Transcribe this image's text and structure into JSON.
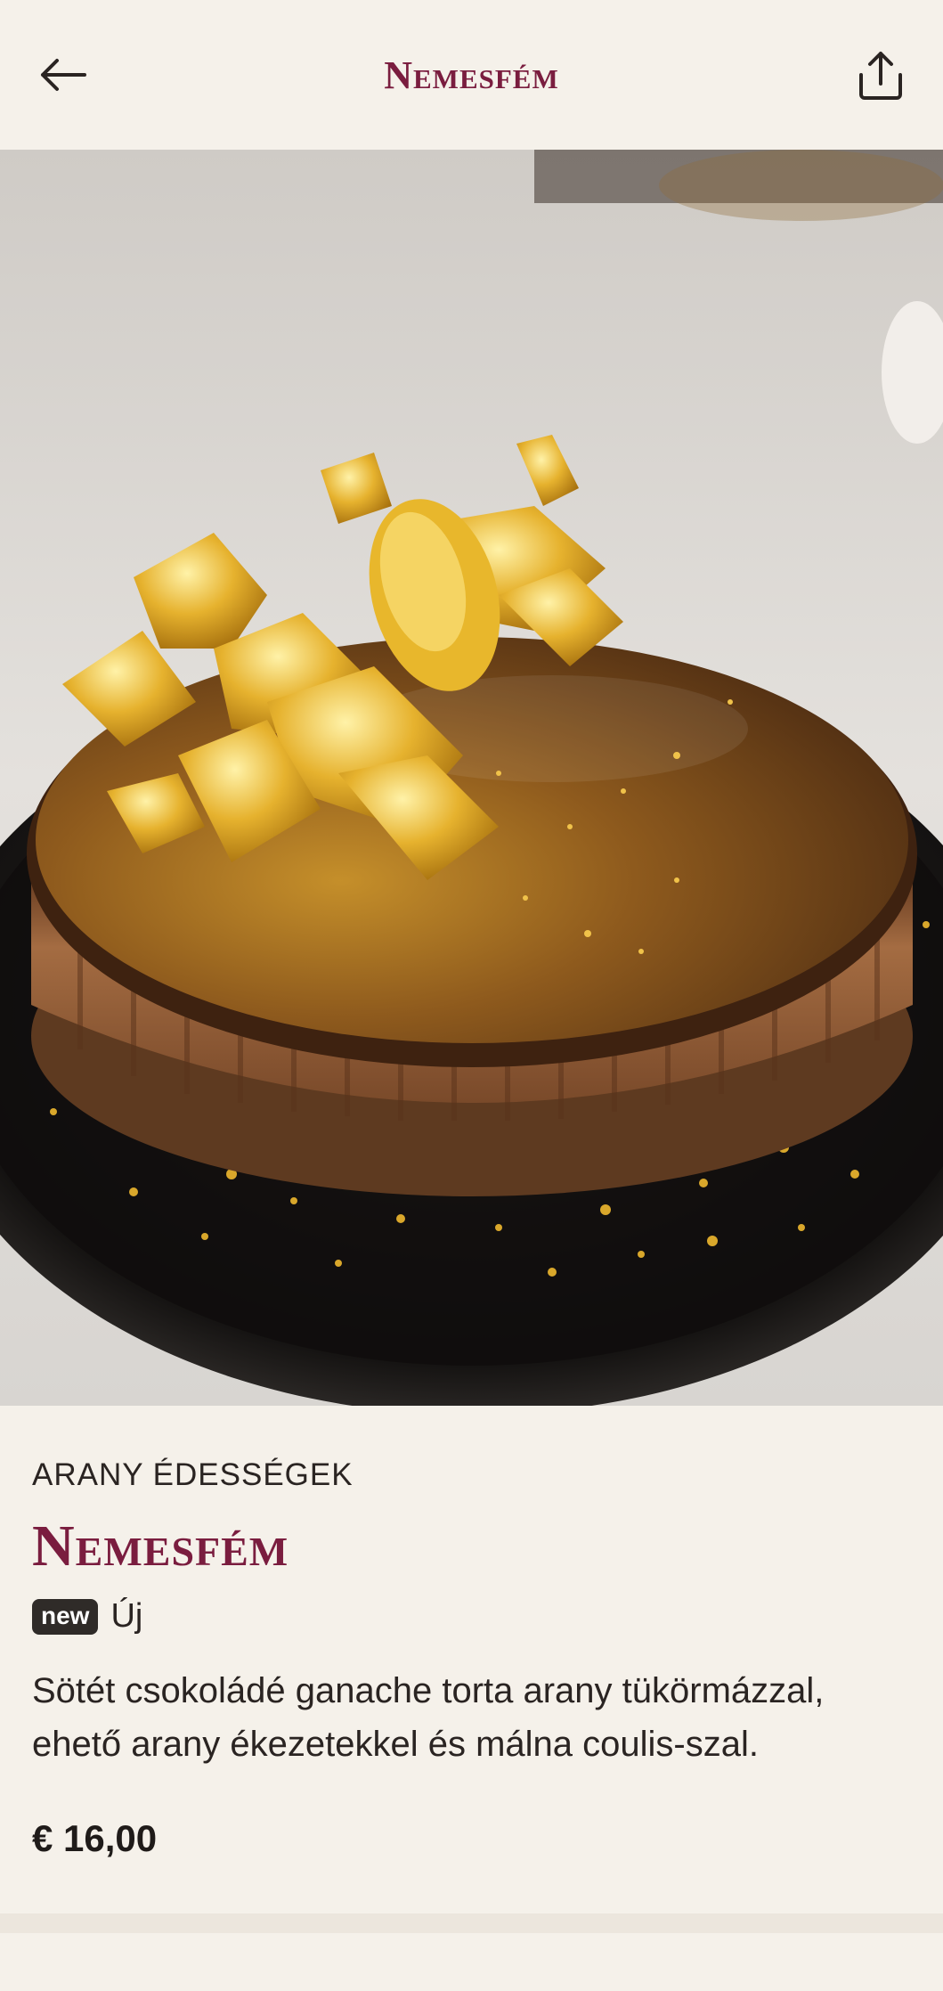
{
  "header": {
    "title": "Nemesfém",
    "back_icon": "arrow-left-icon",
    "share_icon": "share-upload-icon"
  },
  "hero": {
    "image": "chocolate-tart-with-gold-leaf"
  },
  "product": {
    "category": "ARANY ÉDESSÉGEK",
    "name": "Nemesfém",
    "badge": "new",
    "badge_label": "Új",
    "description": "Sötét csokoládé ganache torta arany tükörmázzal, ehető arany ékezetekkel és málna coulis-szal.",
    "price": "€ 16,00"
  },
  "colors": {
    "accent": "#7a1d3f",
    "background": "#f5f1ea",
    "badge": "#2f2b28"
  }
}
